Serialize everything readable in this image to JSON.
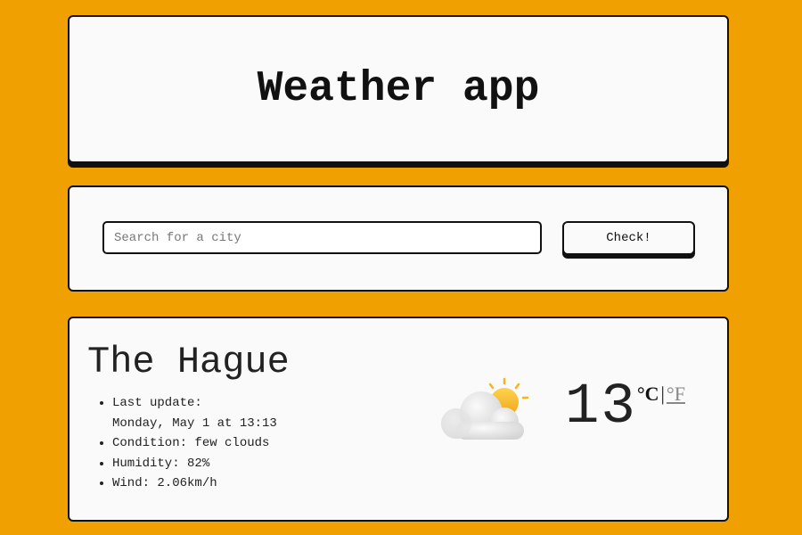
{
  "header": {
    "title": "Weather app"
  },
  "search": {
    "placeholder": "Search for a city",
    "value": "",
    "button_label": "Check!"
  },
  "weather": {
    "city": "The Hague",
    "last_update_label": "Last update:",
    "last_update_value": "Monday, May 1 at 13:13",
    "condition": "Condition: few clouds",
    "humidity": "Humidity: 82%",
    "wind": "Wind: 2.06km/h",
    "icon": "few-clouds-icon",
    "temperature": "13",
    "unit_celsius": "°C",
    "unit_separator": "|",
    "unit_fahrenheit": "°F"
  },
  "colors": {
    "background": "#f0a000",
    "card": "#fafafa",
    "border": "#111111",
    "sun": "#f5b51f",
    "cloud": "#e8e8e8"
  }
}
